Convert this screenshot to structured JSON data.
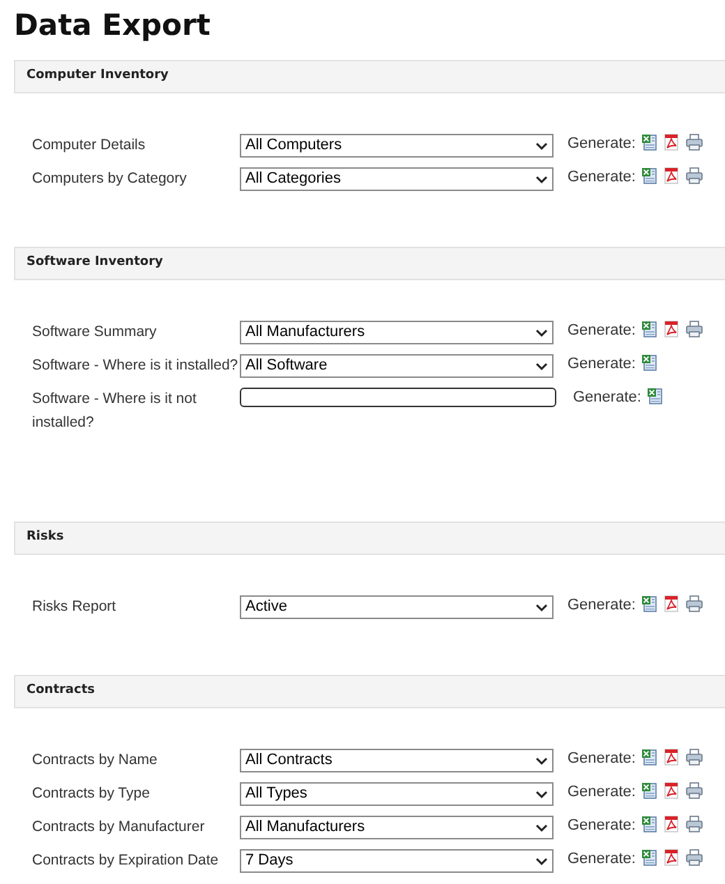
{
  "title": "Data Export",
  "sections": [
    {
      "heading": "Computer Inventory",
      "rows": [
        {
          "label": "Computer Details",
          "kind": "select",
          "value": "All Computers",
          "generate": "Generate:",
          "spreadsheet": true,
          "pdf": true,
          "print": true
        },
        {
          "label": "Computers by Category",
          "kind": "select",
          "value": "All Categories",
          "generate": "Generate:",
          "spreadsheet": true,
          "pdf": true,
          "print": true
        }
      ]
    },
    {
      "heading": "Software Inventory",
      "rows": [
        {
          "label": "Software Summary",
          "kind": "select",
          "value": "All Manufacturers",
          "generate": "Generate:",
          "spreadsheet": true,
          "pdf": true,
          "print": true
        },
        {
          "label": "Software - Where is it installed?",
          "kind": "select",
          "value": "All Software",
          "generate": "Generate:",
          "spreadsheet": true,
          "pdf": false,
          "print": false
        },
        {
          "label": "Software - Where is it not installed?",
          "kind": "text",
          "generate": "Generate:",
          "spreadsheet": true,
          "pdf": false,
          "print": false
        }
      ]
    },
    {
      "heading": "Risks",
      "rows": [
        {
          "label": "Risks Report",
          "kind": "select",
          "value": "Active",
          "generate": "Generate:",
          "spreadsheet": true,
          "pdf": true,
          "print": true
        }
      ]
    },
    {
      "heading": "Contracts",
      "rows": [
        {
          "label": "Contracts by Name",
          "kind": "select",
          "value": "All Contracts",
          "generate": "Generate:",
          "spreadsheet": true,
          "pdf": true,
          "print": true
        },
        {
          "label": "Contracts by Type",
          "kind": "select",
          "value": "All Types",
          "generate": "Generate:",
          "spreadsheet": true,
          "pdf": true,
          "print": true
        },
        {
          "label": "Contracts by Manufacturer",
          "kind": "select",
          "value": "All Manufacturers",
          "generate": "Generate:",
          "spreadsheet": true,
          "pdf": true,
          "print": true
        },
        {
          "label": "Contracts by Expiration Date",
          "kind": "select",
          "value": "7 Days",
          "generate": "Generate:",
          "spreadsheet": true,
          "pdf": true,
          "print": true
        }
      ]
    }
  ]
}
